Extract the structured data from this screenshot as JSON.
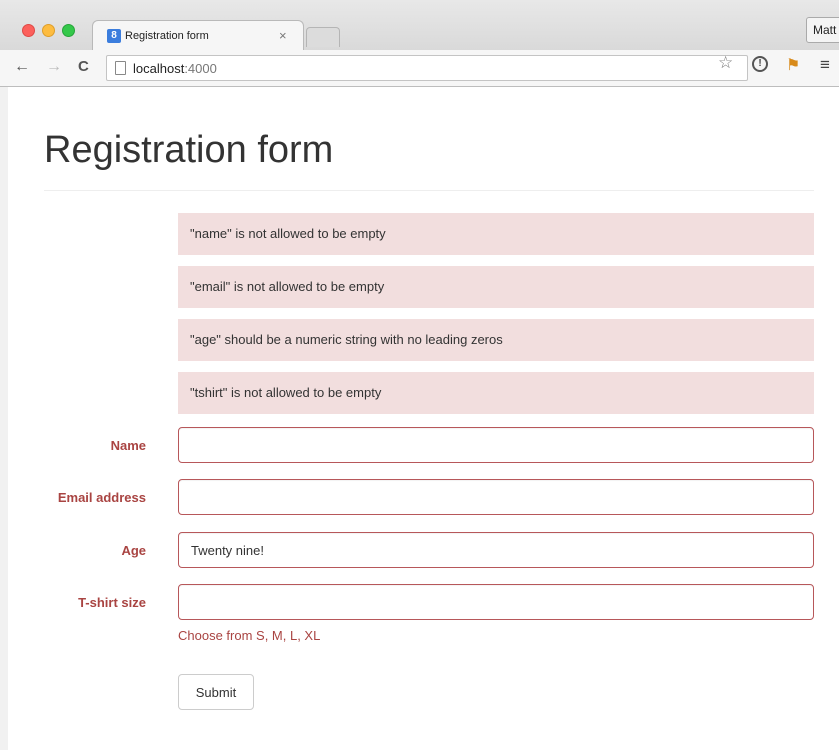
{
  "browser": {
    "tab_title": "Registration form",
    "tab_close": "×",
    "favicon_letter": "8",
    "profile_label": "Matt",
    "url_host": "localhost",
    "url_port": ":4000",
    "icons": {
      "back": "←",
      "forward": "→",
      "reload": "C",
      "star": "☆",
      "extension": "!",
      "extension2": "⚑",
      "menu": "≡"
    }
  },
  "page": {
    "title": "Registration form",
    "errors": [
      "\"name\" is not allowed to be empty",
      "\"email\" is not allowed to be empty",
      "\"age\" should be a numeric string with no leading zeros",
      "\"tshirt\" is not allowed to be empty"
    ],
    "fields": [
      {
        "label": "Name",
        "value": ""
      },
      {
        "label": "Email address",
        "value": ""
      },
      {
        "label": "Age",
        "value": "Twenty nine!"
      },
      {
        "label": "T-shirt size",
        "value": ""
      }
    ],
    "tshirt_help": "Choose from S, M, L, XL",
    "submit_label": "Submit"
  },
  "colors": {
    "error_bg": "#f2dede",
    "error_text": "#a94442",
    "input_border": "#b7575a"
  }
}
